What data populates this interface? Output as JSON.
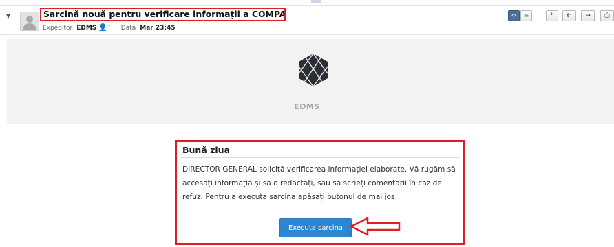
{
  "email": {
    "subject": "Sarcină nouă pentru verificare informații a COMPANIE SRL",
    "sender_label": "Expeditor",
    "sender": "EDMS",
    "date_label": "Data",
    "date": "Mar 23:45"
  },
  "toolbar": {
    "buttons": [
      {
        "name": "source-view",
        "glyph": "‹›"
      },
      {
        "name": "text-view",
        "glyph": "≡"
      },
      {
        "name": "reply",
        "glyph": "↰"
      },
      {
        "name": "reply-all",
        "glyph": "⇇"
      },
      {
        "name": "forward",
        "glyph": "→"
      },
      {
        "name": "print",
        "glyph": "⎙"
      }
    ]
  },
  "banner": {
    "brand": "EDMS"
  },
  "body": {
    "greeting": "Bună ziua",
    "message": "DIRECTOR GENERAL solicită verificarea informației elaborate. Vă rugăm să accesați informația și să o redactați, sau să scrieți comentarii în caz de refuz. Pentru a executa sarcina apăsați butonul de mai jos:",
    "button_label": "Executa sarcina"
  },
  "colors": {
    "highlight": "#dc1f27",
    "button": "#2f86d0",
    "logo": "#2b2f33"
  }
}
